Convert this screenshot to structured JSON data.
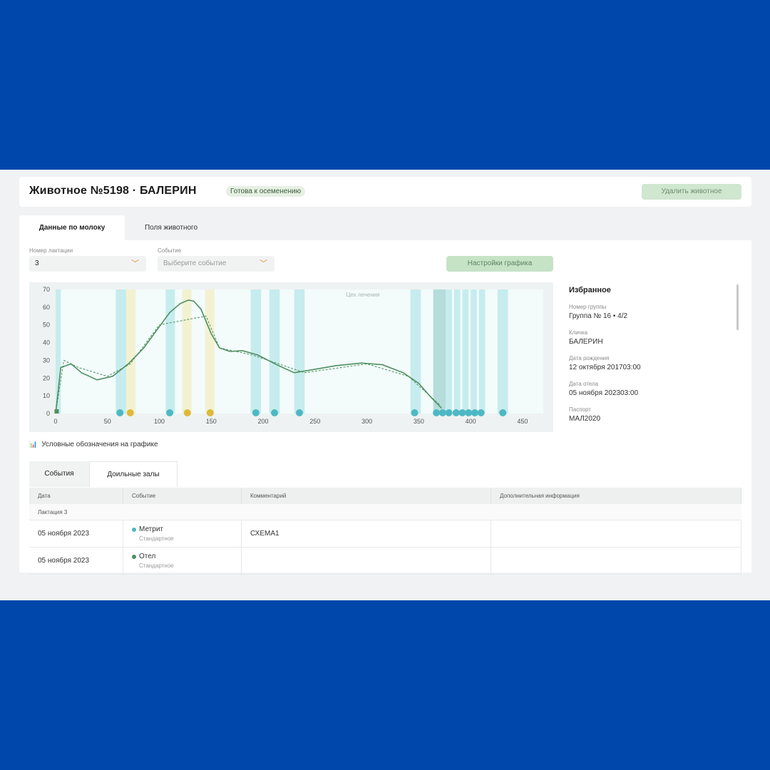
{
  "header": {
    "title": "Животное №5198 · БАЛЕРИН",
    "status": "Готова к осеменению",
    "delete_label": "Удалить животное"
  },
  "tabs": [
    "Данные по молоку",
    "Поля животного"
  ],
  "filters": {
    "lactation_label": "Номер лактации",
    "lactation_value": "3",
    "event_label": "Событие",
    "event_placeholder": "Выберите событие"
  },
  "settings_label": "Настройки графика",
  "chart_data": {
    "type": "line",
    "annotation": "Цех лечения",
    "xlim": [
      0,
      470
    ],
    "ylim": [
      0,
      70
    ],
    "x_ticks": [
      0,
      50,
      100,
      150,
      200,
      250,
      300,
      350,
      400,
      450
    ],
    "y_ticks": [
      0,
      10,
      20,
      30,
      40,
      50,
      60,
      70
    ],
    "series": [
      {
        "style": "solid",
        "color": "#4f8f60",
        "points": [
          [
            0,
            0
          ],
          [
            5,
            26
          ],
          [
            10,
            27
          ],
          [
            15,
            28
          ],
          [
            25,
            23
          ],
          [
            40,
            19
          ],
          [
            55,
            21
          ],
          [
            70,
            28
          ],
          [
            85,
            37
          ],
          [
            100,
            49
          ],
          [
            110,
            57
          ],
          [
            120,
            62
          ],
          [
            128,
            64
          ],
          [
            133,
            63.5
          ],
          [
            140,
            59
          ],
          [
            150,
            45
          ],
          [
            158,
            37
          ],
          [
            168,
            35
          ],
          [
            180,
            35.5
          ],
          [
            195,
            33
          ],
          [
            215,
            27
          ],
          [
            230,
            23
          ],
          [
            250,
            25
          ],
          [
            270,
            27
          ],
          [
            295,
            28.5
          ],
          [
            315,
            27.5
          ],
          [
            335,
            23
          ],
          [
            350,
            17
          ],
          [
            362,
            9
          ],
          [
            372,
            3
          ]
        ]
      },
      {
        "style": "dashed",
        "color": "#4f8f60",
        "points": [
          [
            0,
            0
          ],
          [
            8,
            30
          ],
          [
            22,
            26
          ],
          [
            50,
            21
          ],
          [
            72,
            28
          ],
          [
            100,
            50
          ],
          [
            145,
            55
          ],
          [
            158,
            37
          ],
          [
            190,
            33
          ],
          [
            240,
            23
          ],
          [
            300,
            28
          ],
          [
            340,
            21
          ],
          [
            370,
            5
          ]
        ]
      }
    ],
    "bands": [
      {
        "x": 0,
        "x2": 5,
        "color": "#b7e7e9"
      },
      {
        "x": 58,
        "x2": 68,
        "color": "#b7e7e9"
      },
      {
        "x": 68,
        "x2": 77,
        "color": "#f1efc6"
      },
      {
        "x": 106,
        "x2": 115,
        "color": "#b7e7e9"
      },
      {
        "x": 122,
        "x2": 131,
        "color": "#f1efc6"
      },
      {
        "x": 144,
        "x2": 153,
        "color": "#f1efc6"
      },
      {
        "x": 188,
        "x2": 198,
        "color": "#b7e7e9"
      },
      {
        "x": 206,
        "x2": 216,
        "color": "#b7e7e9"
      },
      {
        "x": 230,
        "x2": 240,
        "color": "#b7e7e9"
      },
      {
        "x": 342,
        "x2": 352,
        "color": "#b7e7e9"
      },
      {
        "x": 364,
        "x2": 376,
        "color": "#9fd3d0"
      },
      {
        "x": 376,
        "x2": 382,
        "color": "#b7e7e9"
      },
      {
        "x": 384,
        "x2": 390,
        "color": "#b7e7e9"
      },
      {
        "x": 392,
        "x2": 398,
        "color": "#b7e7e9"
      },
      {
        "x": 400,
        "x2": 406,
        "color": "#b7e7e9"
      },
      {
        "x": 408,
        "x2": 414,
        "color": "#b7e7e9"
      },
      {
        "x": 426,
        "x2": 436,
        "color": "#b7e7e9"
      }
    ],
    "markers": [
      {
        "x": 1,
        "color": "#4f8f60",
        "shape": "square"
      },
      {
        "x": 62,
        "color": "#4db8c4"
      },
      {
        "x": 72,
        "color": "#e0b83a"
      },
      {
        "x": 110,
        "color": "#4db8c4"
      },
      {
        "x": 127,
        "color": "#e0b83a"
      },
      {
        "x": 149,
        "color": "#e0b83a"
      },
      {
        "x": 193,
        "color": "#4db8c4"
      },
      {
        "x": 211,
        "color": "#4db8c4"
      },
      {
        "x": 235,
        "color": "#4db8c4"
      },
      {
        "x": 346,
        "color": "#4db8c4"
      },
      {
        "x": 367,
        "color": "#4db8c4"
      },
      {
        "x": 373,
        "color": "#4db8c4"
      },
      {
        "x": 379,
        "color": "#4db8c4"
      },
      {
        "x": 386,
        "color": "#4db8c4"
      },
      {
        "x": 392,
        "color": "#4db8c4"
      },
      {
        "x": 398,
        "color": "#4db8c4"
      },
      {
        "x": 404,
        "color": "#4db8c4"
      },
      {
        "x": 410,
        "color": "#4db8c4"
      },
      {
        "x": 431,
        "color": "#4db8c4"
      }
    ]
  },
  "favorites": {
    "title": "Избранное",
    "fields": [
      {
        "label": "Номер группы",
        "value": "Группа № 16 • 4/2"
      },
      {
        "label": "Кличка",
        "value": "БАЛЕРИН"
      },
      {
        "label": "Дата рождения",
        "value": "12 октября 201703:00"
      },
      {
        "label": "Дата отела",
        "value": "05 ноября 202303:00"
      },
      {
        "label": "Паспорт",
        "value": "МАЛ2020"
      }
    ]
  },
  "legend_label": "Условные обозначения на графике",
  "events_tabs": [
    "События",
    "Доильные залы"
  ],
  "table": {
    "headers": [
      "Дата",
      "Событие",
      "Комментарий",
      "Дополнительная информация"
    ],
    "group": "Лактация 3",
    "rows": [
      {
        "date": "05 ноября 2023",
        "event": "Метрит",
        "event_color": "#4db8c4",
        "type": "Стандартное",
        "comment": "СХЕМА1",
        "info": ""
      },
      {
        "date": "05 ноября 2023",
        "event": "Отел",
        "event_color": "#4f8f60",
        "type": "Стандартное",
        "comment": "",
        "info": ""
      }
    ]
  }
}
